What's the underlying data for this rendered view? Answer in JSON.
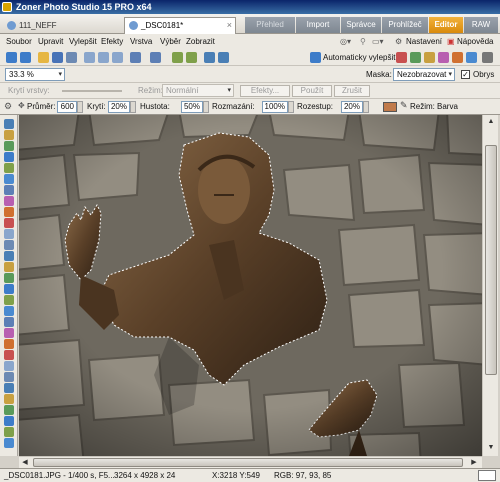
{
  "window": {
    "title": "Zoner Photo Studio 15 PRO x64"
  },
  "doc_tabs": [
    {
      "label": "111_NEFF",
      "active": false
    },
    {
      "label": "_DSC0181*",
      "active": true
    }
  ],
  "mode_tabs": [
    {
      "label": "Přehled",
      "disabled": true
    },
    {
      "label": "Import"
    },
    {
      "label": "Správce"
    },
    {
      "label": "Prohlížeč"
    },
    {
      "label": "Editor",
      "active": true
    },
    {
      "label": "RAW"
    }
  ],
  "menu": [
    {
      "label": "Soubor",
      "key": "S"
    },
    {
      "label": "Upravit",
      "key": "U"
    },
    {
      "label": "Vylepšit",
      "key": "V"
    },
    {
      "label": "Efekty",
      "key": "E"
    },
    {
      "label": "Vrstva",
      "key": "r"
    },
    {
      "label": "Výběr",
      "key": "ý"
    },
    {
      "label": "Zobrazit",
      "key": "Z"
    }
  ],
  "menu_right": {
    "settings": "Nastavení",
    "help": "Nápověda"
  },
  "toolbar": {
    "auto_enhance": "Automaticky vylepšit"
  },
  "zoom_row": {
    "zoom": "33.3 %",
    "mask_label": "Maska:",
    "mask_value": "Nezobrazovat",
    "outline_label": "Obrys",
    "outline_checked": true
  },
  "layer_row": {
    "opacity_label": "Krytí vrstvy:",
    "mode_label": "Režim:",
    "mode_value": "Normální",
    "effects_button": "Efekty...",
    "apply_button": "Použít",
    "cancel_button": "Zrušit"
  },
  "brush_row": {
    "diameter_label": "Průměr:",
    "diameter": "600",
    "opacity_label": "Krytí:",
    "opacity": "20%",
    "density_label": "Hustota:",
    "density": "50%",
    "blur_label": "Rozmazání:",
    "blur": "100%",
    "spacing_label": "Rozestup:",
    "spacing": "20%",
    "brush_color": "#c07a4a",
    "mode_label": "Režim:",
    "mode_value": "Barva"
  },
  "status": {
    "file": "_DSC0181.JPG - 1/400 s, F5...",
    "size": "3264 x 4928 x 24",
    "coords": "X:3218 Y:549",
    "rgb": "RGB: 97, 93, 85"
  },
  "colors": {
    "accent_editor": "#e79a1c",
    "titlebar": "#0a246a"
  }
}
